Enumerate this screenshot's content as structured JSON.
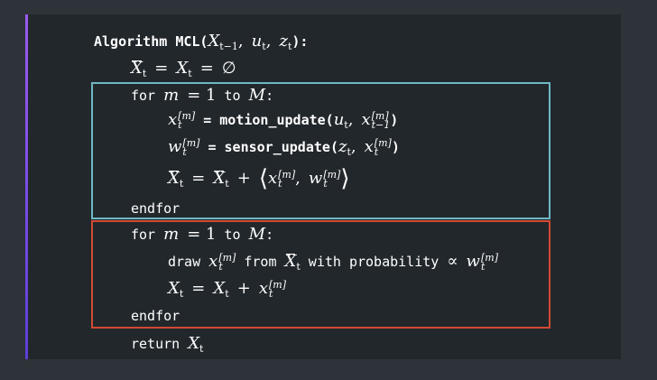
{
  "algorithm": {
    "keyword": "Algorithm",
    "name": "MCL",
    "args": "X_{t-1}, u_t, z_t",
    "colon": ":"
  },
  "lines": {
    "init": "X̄_t = X_t = Ø",
    "for1_kw": "for",
    "for1_range": "m = 1",
    "to": "to",
    "M": "M",
    "motion_update": "motion_update",
    "sensor_update": "sensor_update",
    "endfor": "endfor",
    "draw": "draw",
    "from": "from",
    "with_probability": "with probability",
    "return": "return"
  },
  "colors": {
    "background": "#2d3338",
    "panel": "#22272c",
    "accent": "#8a52f0",
    "box_blue": "#6fb8c4",
    "box_red": "#d14a32"
  }
}
